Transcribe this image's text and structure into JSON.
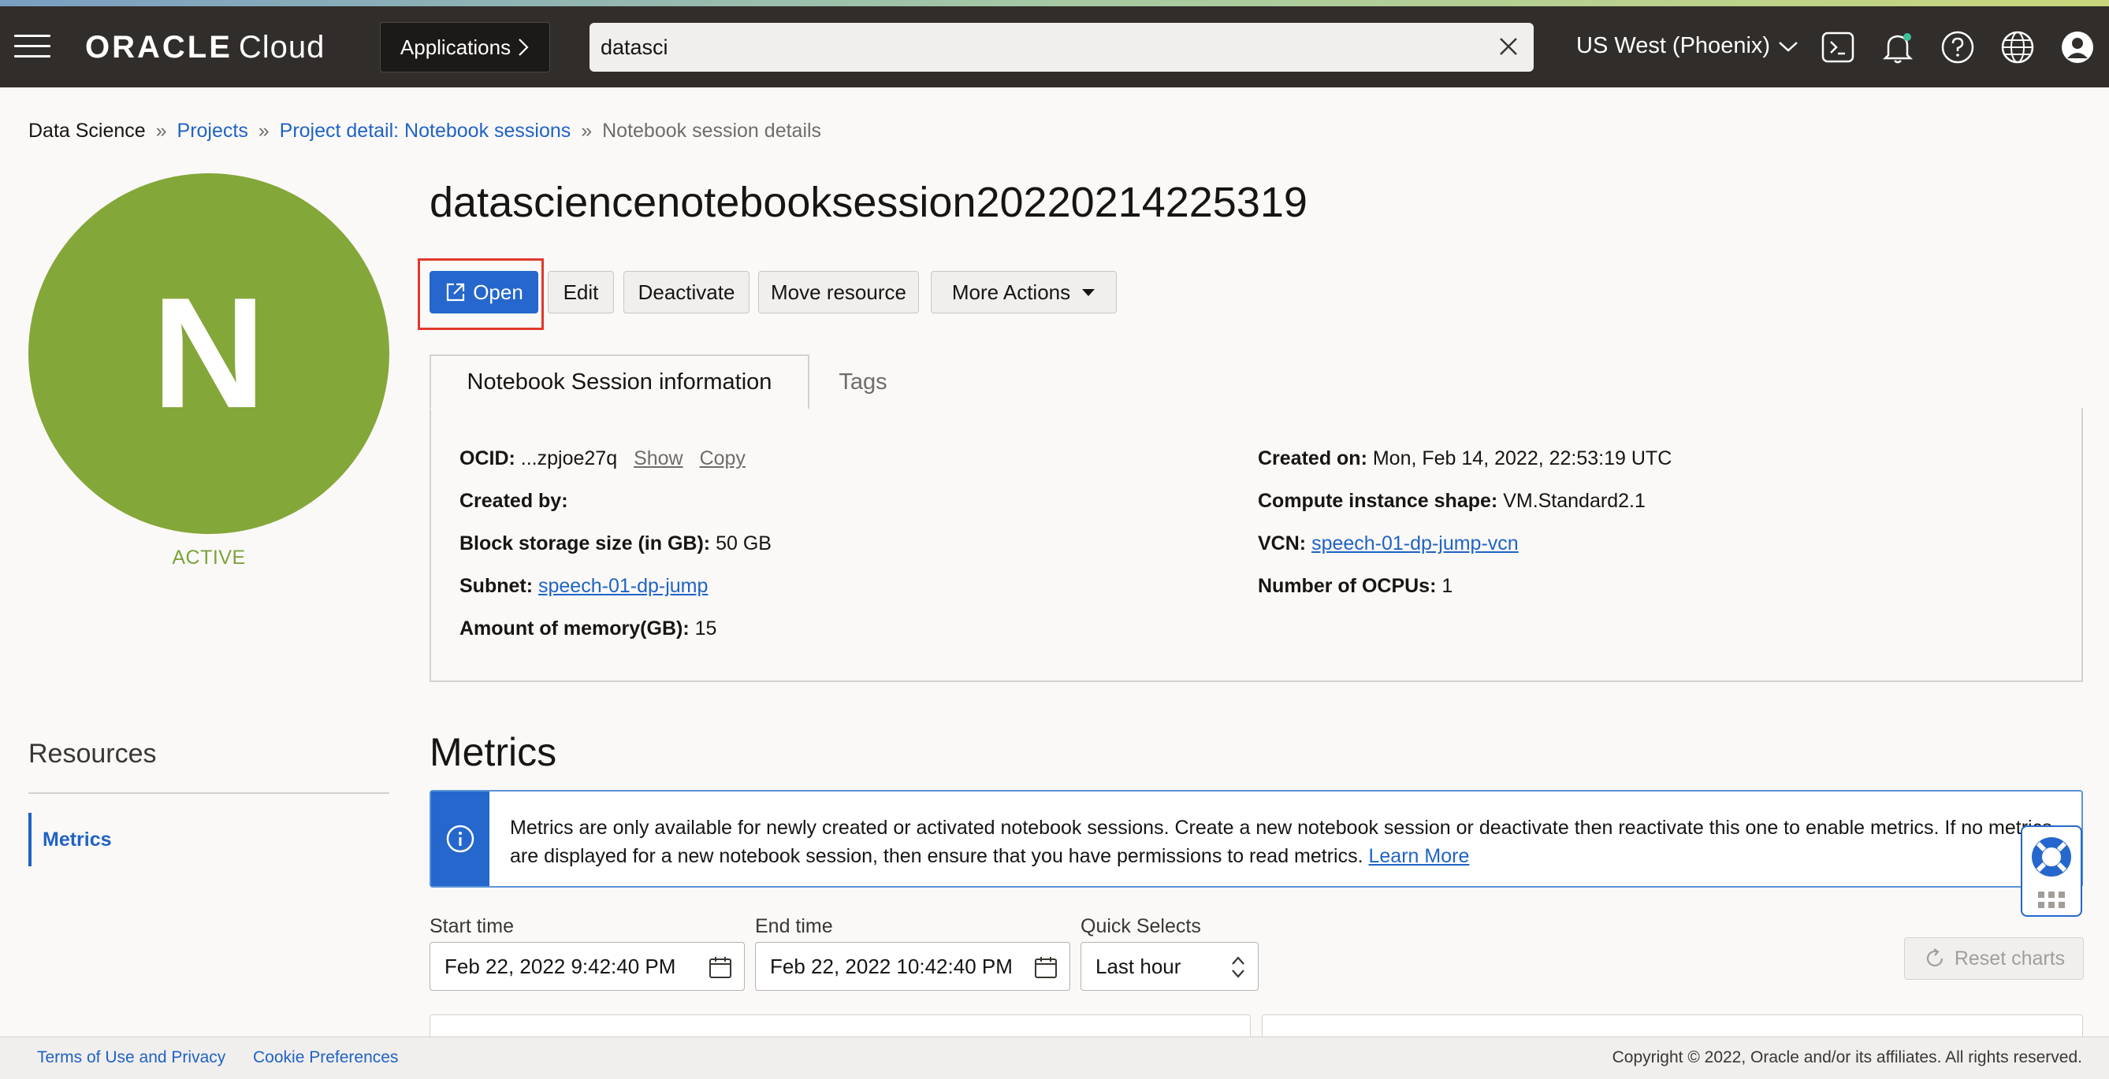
{
  "header": {
    "logo_brand": "ORACLE",
    "logo_product": "Cloud",
    "applications_label": "Applications",
    "search_value": "datasci",
    "region_label": "US West (Phoenix)"
  },
  "breadcrumb": {
    "root": "Data Science",
    "projects": "Projects",
    "project_detail": "Project detail: Notebook sessions",
    "current": "Notebook session details",
    "separator": "»"
  },
  "avatar": {
    "letter": "N",
    "status": "ACTIVE",
    "color": "#84a73a"
  },
  "page_title": "datasciencenotebooksession20220214225319",
  "actions": {
    "open": "Open",
    "edit": "Edit",
    "deactivate": "Deactivate",
    "move": "Move resource",
    "more": "More Actions"
  },
  "tabs": [
    "Notebook Session information",
    "Tags"
  ],
  "info": {
    "ocid_label": "OCID:",
    "ocid_value": "...zpjoe27q",
    "ocid_show": "Show",
    "ocid_copy": "Copy",
    "created_by_label": "Created by:",
    "block_storage_label": "Block storage size (in GB):",
    "block_storage_value": "50 GB",
    "subnet_label": "Subnet:",
    "subnet_value": "speech-01-dp-jump",
    "memory_label": "Amount of memory(GB):",
    "memory_value": "15",
    "created_on_label": "Created on:",
    "created_on_value": "Mon, Feb 14, 2022, 22:53:19 UTC",
    "shape_label": "Compute instance shape:",
    "shape_value": "VM.Standard2.1",
    "vcn_label": "VCN:",
    "vcn_value": "speech-01-dp-jump-vcn",
    "ocpus_label": "Number of OCPUs:",
    "ocpus_value": "1"
  },
  "resources": {
    "title": "Resources",
    "items": [
      "Metrics"
    ]
  },
  "metrics": {
    "title": "Metrics",
    "notice_text": "Metrics are only available for newly created or activated notebook sessions. Create a new notebook session or deactivate then reactivate this one to enable metrics. If no metrics are displayed for a new notebook session, then ensure that you have permissions to read metrics.",
    "notice_link": "Learn More",
    "start_label": "Start time",
    "start_value": "Feb 22, 2022 9:42:40 PM",
    "end_label": "End time",
    "end_value": "Feb 22, 2022 10:42:40 PM",
    "quick_label": "Quick Selects",
    "quick_value": "Last hour",
    "reset_label": "Reset charts"
  },
  "footer": {
    "terms": "Terms of Use and Privacy",
    "cookies": "Cookie Preferences",
    "copyright": "Copyright © 2022, Oracle and/or its affiliates. All rights reserved."
  },
  "colors": {
    "header_bg": "#312d2a",
    "primary": "#2567cc",
    "link": "#1f63c5",
    "active_status": "#7ba33a",
    "highlight": "#e0392c"
  }
}
